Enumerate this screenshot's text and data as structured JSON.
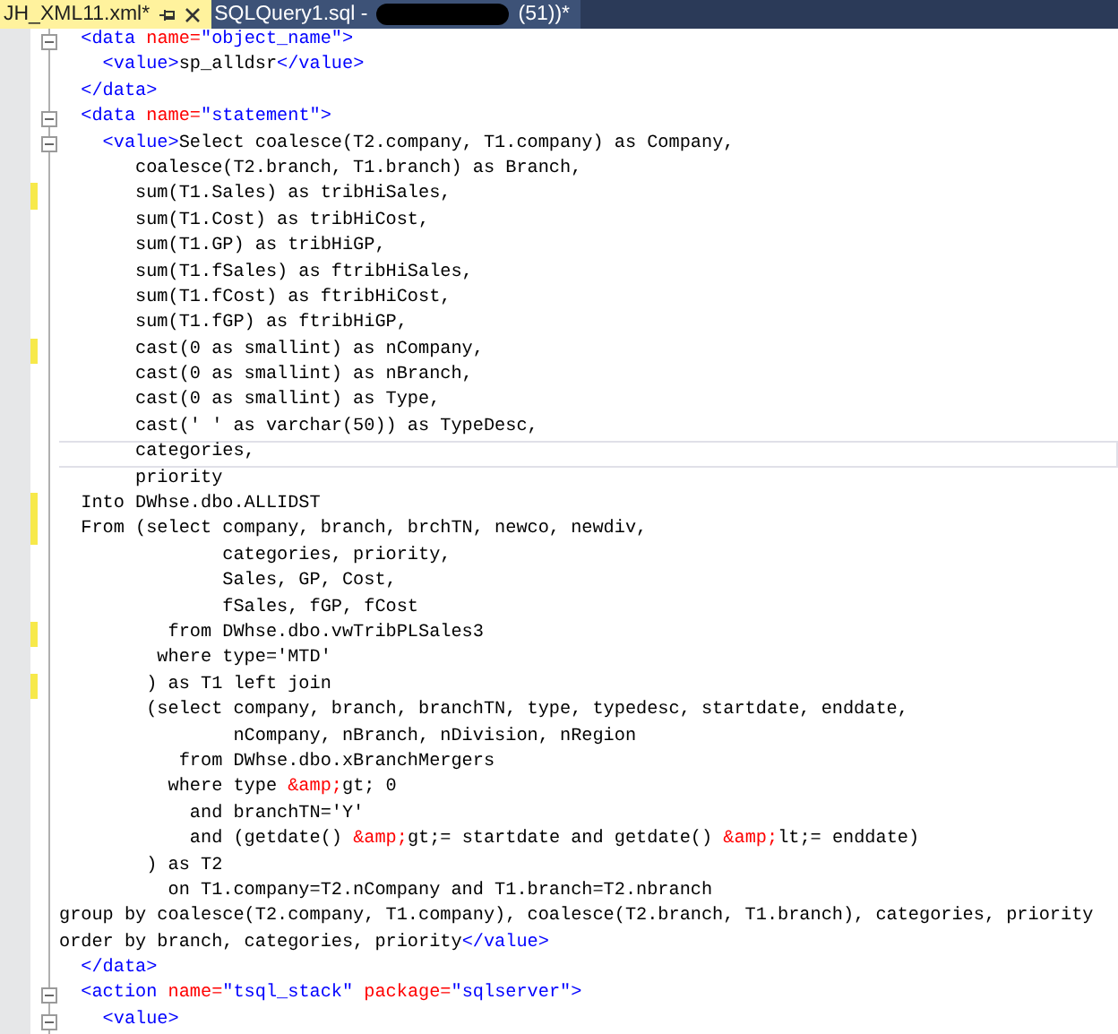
{
  "tabs": [
    {
      "label": "JH_XML11.xml*",
      "selected": true
    },
    {
      "label": "SQLQuery1.sql -",
      "label_end": "(51))*",
      "selected": false
    }
  ],
  "editor": {
    "lines": [
      {
        "fold": true,
        "changed": false,
        "current": false,
        "segments": [
          {
            "kind": "tag",
            "text": "  <data"
          },
          {
            "kind": "attr",
            "text": " name="
          },
          {
            "kind": "string",
            "text": "\"object_name\""
          },
          {
            "kind": "tag",
            "text": ">"
          }
        ]
      },
      {
        "fold": false,
        "changed": false,
        "current": false,
        "segments": [
          {
            "kind": "tag",
            "text": "    <value>"
          },
          {
            "kind": "text",
            "text": "sp_alldsr"
          },
          {
            "kind": "tag",
            "text": "</value>"
          }
        ]
      },
      {
        "fold": false,
        "changed": false,
        "current": false,
        "segments": [
          {
            "kind": "tag",
            "text": "  </data>"
          }
        ]
      },
      {
        "fold": true,
        "changed": false,
        "current": false,
        "segments": [
          {
            "kind": "tag",
            "text": "  <data"
          },
          {
            "kind": "attr",
            "text": " name="
          },
          {
            "kind": "string",
            "text": "\"statement\""
          },
          {
            "kind": "tag",
            "text": ">"
          }
        ]
      },
      {
        "fold": true,
        "changed": false,
        "current": false,
        "segments": [
          {
            "kind": "tag",
            "text": "    <value>"
          },
          {
            "kind": "text",
            "text": "Select coalesce(T2.company, T1.company) as Company,"
          }
        ]
      },
      {
        "fold": false,
        "changed": false,
        "current": false,
        "segments": [
          {
            "kind": "text",
            "text": "       coalesce(T2.branch, T1.branch) as Branch,"
          }
        ]
      },
      {
        "fold": false,
        "changed": true,
        "current": false,
        "segments": [
          {
            "kind": "text",
            "text": "       sum(T1.Sales) as tribHiSales,"
          }
        ]
      },
      {
        "fold": false,
        "changed": false,
        "current": false,
        "segments": [
          {
            "kind": "text",
            "text": "       sum(T1.Cost) as tribHiCost,"
          }
        ]
      },
      {
        "fold": false,
        "changed": false,
        "current": false,
        "segments": [
          {
            "kind": "text",
            "text": "       sum(T1.GP) as tribHiGP,"
          }
        ]
      },
      {
        "fold": false,
        "changed": false,
        "current": false,
        "segments": [
          {
            "kind": "text",
            "text": "       sum(T1.fSales) as ftribHiSales,"
          }
        ]
      },
      {
        "fold": false,
        "changed": false,
        "current": false,
        "segments": [
          {
            "kind": "text",
            "text": "       sum(T1.fCost) as ftribHiCost,"
          }
        ]
      },
      {
        "fold": false,
        "changed": false,
        "current": false,
        "segments": [
          {
            "kind": "text",
            "text": "       sum(T1.fGP) as ftribHiGP,"
          }
        ]
      },
      {
        "fold": false,
        "changed": true,
        "current": false,
        "segments": [
          {
            "kind": "text",
            "text": "       cast(0 as smallint) as nCompany,"
          }
        ]
      },
      {
        "fold": false,
        "changed": false,
        "current": false,
        "segments": [
          {
            "kind": "text",
            "text": "       cast(0 as smallint) as nBranch,"
          }
        ]
      },
      {
        "fold": false,
        "changed": false,
        "current": false,
        "segments": [
          {
            "kind": "text",
            "text": "       cast(0 as smallint) as Type,"
          }
        ]
      },
      {
        "fold": false,
        "changed": false,
        "current": false,
        "segments": [
          {
            "kind": "text",
            "text": "       cast(' ' as varchar(50)) as TypeDesc,"
          }
        ]
      },
      {
        "fold": false,
        "changed": false,
        "current": true,
        "segments": [
          {
            "kind": "text",
            "text": "       categories,"
          }
        ]
      },
      {
        "fold": false,
        "changed": false,
        "current": false,
        "segments": [
          {
            "kind": "text",
            "text": "       priority"
          }
        ]
      },
      {
        "fold": false,
        "changed": true,
        "current": false,
        "segments": [
          {
            "kind": "text",
            "text": "  Into DWhse.dbo.ALLIDST"
          }
        ]
      },
      {
        "fold": false,
        "changed": true,
        "current": false,
        "segments": [
          {
            "kind": "text",
            "text": "  From (select company, branch, brchTN, newco, newdiv,"
          }
        ]
      },
      {
        "fold": false,
        "changed": false,
        "current": false,
        "segments": [
          {
            "kind": "text",
            "text": "               categories, priority,"
          }
        ]
      },
      {
        "fold": false,
        "changed": false,
        "current": false,
        "segments": [
          {
            "kind": "text",
            "text": "               Sales, GP, Cost,"
          }
        ]
      },
      {
        "fold": false,
        "changed": false,
        "current": false,
        "segments": [
          {
            "kind": "text",
            "text": "               fSales, fGP, fCost"
          }
        ]
      },
      {
        "fold": false,
        "changed": true,
        "current": false,
        "segments": [
          {
            "kind": "text",
            "text": "          from DWhse.dbo.vwTribPLSales3"
          }
        ]
      },
      {
        "fold": false,
        "changed": false,
        "current": false,
        "segments": [
          {
            "kind": "text",
            "text": "         where type='MTD'"
          }
        ]
      },
      {
        "fold": false,
        "changed": true,
        "current": false,
        "segments": [
          {
            "kind": "text",
            "text": "        ) as T1 left join"
          }
        ]
      },
      {
        "fold": false,
        "changed": false,
        "current": false,
        "segments": [
          {
            "kind": "text",
            "text": "        (select company, branch, branchTN, type, typedesc, startdate, enddate,"
          }
        ]
      },
      {
        "fold": false,
        "changed": false,
        "current": false,
        "segments": [
          {
            "kind": "text",
            "text": "                nCompany, nBranch, nDivision, nRegion"
          }
        ]
      },
      {
        "fold": false,
        "changed": false,
        "current": false,
        "segments": [
          {
            "kind": "text",
            "text": "           from DWhse.dbo.xBranchMergers"
          }
        ]
      },
      {
        "fold": false,
        "changed": false,
        "current": false,
        "segments": [
          {
            "kind": "text",
            "text": "          where type "
          },
          {
            "kind": "entity",
            "text": "&amp;"
          },
          {
            "kind": "text",
            "text": "gt; 0"
          }
        ]
      },
      {
        "fold": false,
        "changed": false,
        "current": false,
        "segments": [
          {
            "kind": "text",
            "text": "            and branchTN='Y'"
          }
        ]
      },
      {
        "fold": false,
        "changed": false,
        "current": false,
        "segments": [
          {
            "kind": "text",
            "text": "            and (getdate() "
          },
          {
            "kind": "entity",
            "text": "&amp;"
          },
          {
            "kind": "text",
            "text": "gt;= startdate and getdate() "
          },
          {
            "kind": "entity",
            "text": "&amp;"
          },
          {
            "kind": "text",
            "text": "lt;= enddate)"
          }
        ]
      },
      {
        "fold": false,
        "changed": false,
        "current": false,
        "segments": [
          {
            "kind": "text",
            "text": "        ) as T2"
          }
        ]
      },
      {
        "fold": false,
        "changed": false,
        "current": false,
        "segments": [
          {
            "kind": "text",
            "text": "          on T1.company=T2.nCompany and T1.branch=T2.nbranch"
          }
        ]
      },
      {
        "fold": false,
        "changed": false,
        "current": false,
        "segments": [
          {
            "kind": "text",
            "text": "group by coalesce(T2.company, T1.company), coalesce(T2.branch, T1.branch), categories, priority"
          }
        ]
      },
      {
        "fold": false,
        "changed": false,
        "current": false,
        "segments": [
          {
            "kind": "text",
            "text": "order by branch, categories, priority"
          },
          {
            "kind": "tag",
            "text": "</value>"
          }
        ]
      },
      {
        "fold": false,
        "changed": false,
        "current": false,
        "segments": [
          {
            "kind": "tag",
            "text": "  </data>"
          }
        ]
      },
      {
        "fold": true,
        "changed": false,
        "current": false,
        "segments": [
          {
            "kind": "tag",
            "text": "  <action"
          },
          {
            "kind": "attr",
            "text": " name="
          },
          {
            "kind": "string",
            "text": "\"tsql_stack\""
          },
          {
            "kind": "attr",
            "text": " package="
          },
          {
            "kind": "string",
            "text": "\"sqlserver\""
          },
          {
            "kind": "tag",
            "text": ">"
          }
        ]
      },
      {
        "fold": true,
        "changed": false,
        "current": false,
        "segments": [
          {
            "kind": "tag",
            "text": "    <value>"
          }
        ]
      }
    ]
  }
}
